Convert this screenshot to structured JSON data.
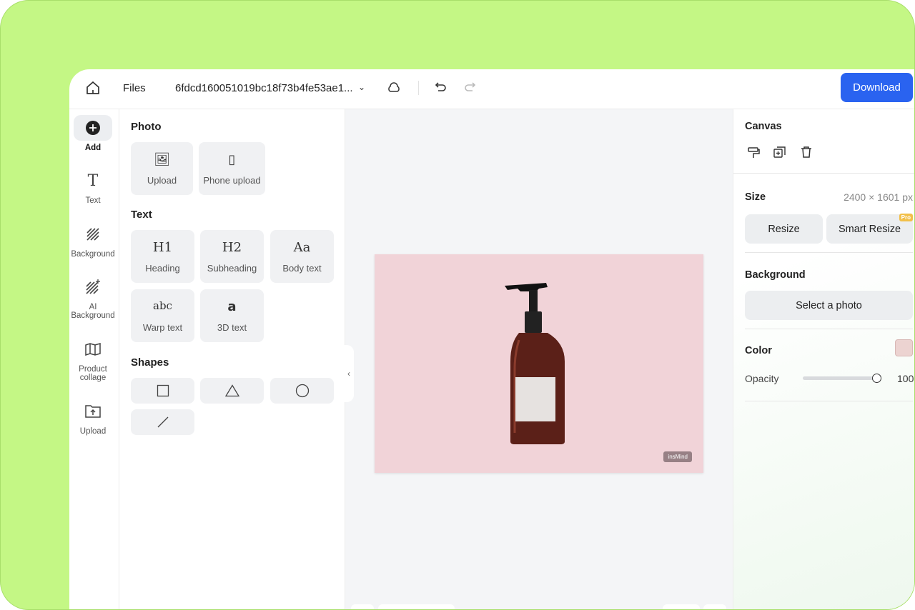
{
  "header": {
    "files_label": "Files",
    "file_name": "6fdcd160051019bc18f73b4fe53ae1...",
    "download_label": "Download"
  },
  "rail": {
    "items": [
      {
        "label": "Add"
      },
      {
        "label": "Text"
      },
      {
        "label": "Background"
      },
      {
        "label": "AI Background"
      },
      {
        "label": "Product collage"
      },
      {
        "label": "Upload"
      }
    ]
  },
  "panel": {
    "photo": {
      "title": "Photo",
      "items": [
        {
          "label": "Upload"
        },
        {
          "label": "Phone upload"
        }
      ]
    },
    "text": {
      "title": "Text",
      "items": [
        {
          "glyph": "H1",
          "label": "Heading"
        },
        {
          "glyph": "H2",
          "label": "Subheading"
        },
        {
          "glyph": "Aa",
          "label": "Body text"
        },
        {
          "glyph": "abc",
          "label": "Warp text"
        },
        {
          "glyph": "a",
          "label": "3D text"
        }
      ]
    },
    "shapes": {
      "title": "Shapes",
      "items": [
        "square",
        "triangle",
        "circle",
        "line"
      ]
    }
  },
  "canvas": {
    "watermark": "insMind",
    "background_color": "#f1d3d8"
  },
  "props": {
    "title": "Canvas",
    "size_label": "Size",
    "size_value": "2400 × 1601 px",
    "resize_label": "Resize",
    "smart_resize_label": "Smart Resize",
    "pro_badge": "Pro",
    "background_label": "Background",
    "select_photo_label": "Select a photo",
    "color_label": "Color",
    "color_value": "#ecd3d1",
    "opacity_label": "Opacity",
    "opacity_value": "100"
  },
  "colors": {
    "accent": "#2a63f0",
    "frame": "#c4f785"
  }
}
